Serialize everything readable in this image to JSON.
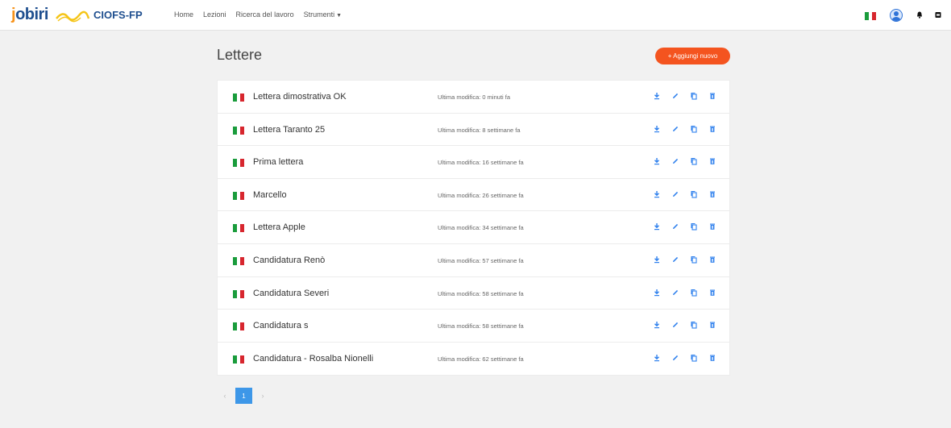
{
  "header": {
    "logo_primary": "jobiri",
    "logo_secondary": "CIOFS-FP",
    "nav": [
      {
        "label": "Home"
      },
      {
        "label": "Lezioni"
      },
      {
        "label": "Ricerca del lavoro"
      },
      {
        "label": "Strumenti"
      }
    ]
  },
  "page": {
    "title": "Lettere",
    "add_button": "+ Aggiungi nuovo"
  },
  "letters": [
    {
      "name": "Lettera dimostrativa OK",
      "modified": "Ultima modifica: 0 minuti fa"
    },
    {
      "name": "Lettera Taranto 25",
      "modified": "Ultima modifica: 8 settimane fa"
    },
    {
      "name": "Prima lettera",
      "modified": "Ultima modifica: 16 settimane fa"
    },
    {
      "name": "Marcello",
      "modified": "Ultima modifica: 26 settimane fa"
    },
    {
      "name": "Lettera Apple",
      "modified": "Ultima modifica: 34 settimane fa"
    },
    {
      "name": "Candidatura Renò",
      "modified": "Ultima modifica: 57 settimane fa"
    },
    {
      "name": "Candidatura Severi",
      "modified": "Ultima modifica: 58 settimane fa"
    },
    {
      "name": "Candidatura s",
      "modified": "Ultima modifica: 58 settimane fa"
    },
    {
      "name": "Candidatura - Rosalba Nionelli",
      "modified": "Ultima modifica: 62 settimane fa"
    }
  ],
  "pagination": {
    "prev": "‹",
    "current": "1",
    "next": "›"
  },
  "colors": {
    "accent": "#f4541f",
    "action_icon": "#2f80ed",
    "page_active": "#3d97e8"
  },
  "icons": [
    "download-icon",
    "edit-icon",
    "copy-icon",
    "delete-icon",
    "italian-flag-icon",
    "user-avatar-icon",
    "bell-icon",
    "logout-icon"
  ]
}
